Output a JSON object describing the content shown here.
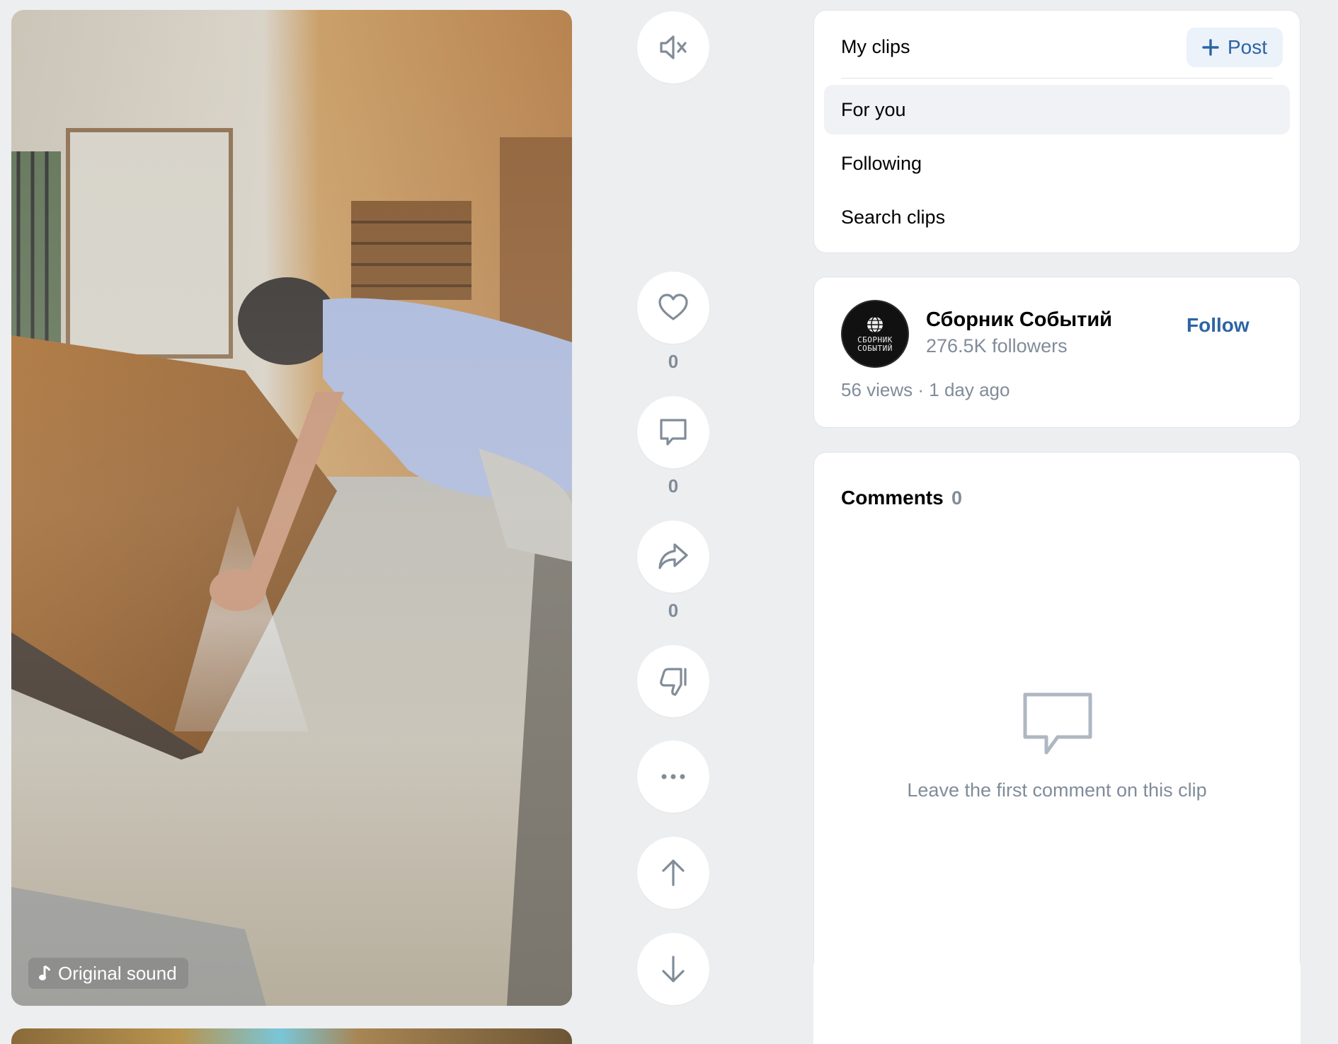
{
  "video": {
    "sound_label": "Original sound"
  },
  "rail": {
    "mute_icon": "mute-icon",
    "like_count": "0",
    "comment_count": "0",
    "share_count": "0"
  },
  "nav": {
    "title": "My clips",
    "post_label": "Post",
    "items": [
      {
        "label": "For you",
        "active": true
      },
      {
        "label": "Following",
        "active": false
      },
      {
        "label": "Search clips",
        "active": false
      }
    ]
  },
  "author": {
    "name": "Сборник Событий",
    "followers": "276.5K followers",
    "follow_label": "Follow",
    "views": "56 views · 1 day ago",
    "avatar_text_1": "СБОРНИК",
    "avatar_text_2": "СОБЫТИЙ"
  },
  "comments": {
    "title": "Comments",
    "count": "0",
    "empty_text": "Leave the first comment on this clip"
  },
  "colors": {
    "accent": "#2d64a4",
    "muted": "#818c99",
    "background": "#edeef0"
  }
}
